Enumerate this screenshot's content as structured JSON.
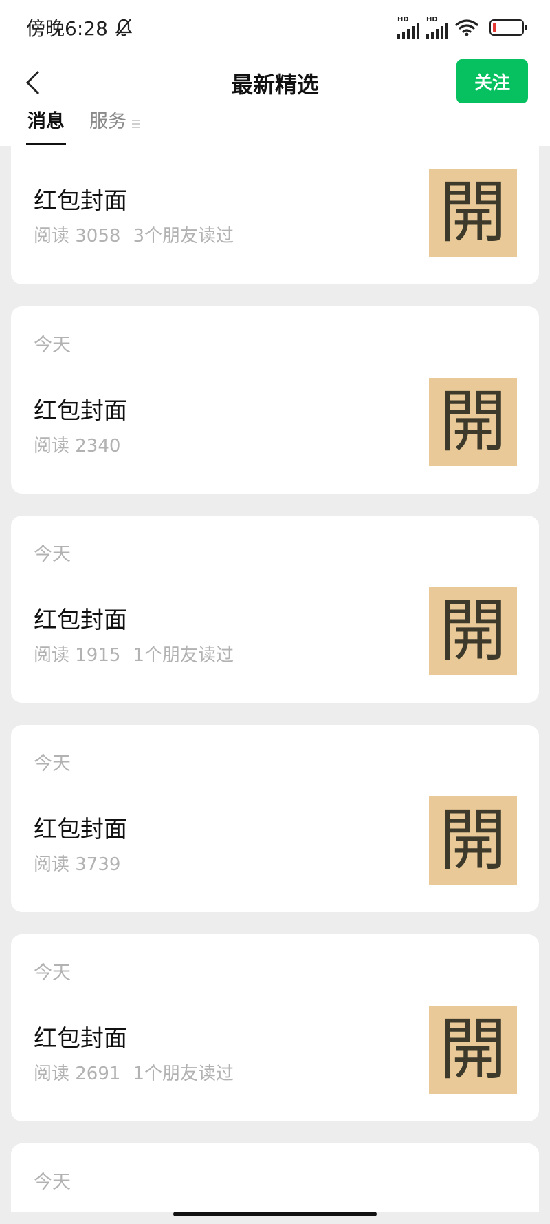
{
  "status_bar": {
    "time": "傍晚6:28",
    "icons": [
      "mute-bell-icon",
      "hd-signal-icon",
      "hd-signal-icon",
      "wifi-icon",
      "battery-low-icon"
    ],
    "hd_label": "HD",
    "battery_color": "#e53935"
  },
  "header": {
    "title": "最新精选",
    "follow_label": "关注",
    "accent_color": "#07c160"
  },
  "tabs": [
    {
      "label": "消息",
      "active": true
    },
    {
      "label": "服务",
      "active": false
    }
  ],
  "articles": [
    {
      "date": "",
      "title": "红包封面",
      "reads": "阅读 3058",
      "friends": "3个朋友读过",
      "thumb_glyph": "開"
    },
    {
      "date": "今天",
      "title": "红包封面",
      "reads": "阅读 2340",
      "friends": "",
      "thumb_glyph": "開"
    },
    {
      "date": "今天",
      "title": "红包封面",
      "reads": "阅读 1915",
      "friends": "1个朋友读过",
      "thumb_glyph": "開"
    },
    {
      "date": "今天",
      "title": "红包封面",
      "reads": "阅读 3739",
      "friends": "",
      "thumb_glyph": "開"
    },
    {
      "date": "今天",
      "title": "红包封面",
      "reads": "阅读 2691",
      "friends": "1个朋友读过",
      "thumb_glyph": "開"
    },
    {
      "date": "今天"
    }
  ]
}
